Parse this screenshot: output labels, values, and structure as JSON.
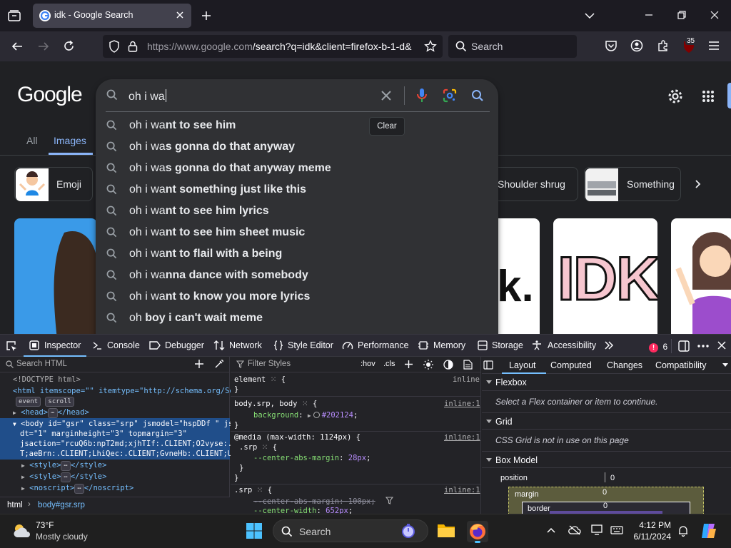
{
  "browser": {
    "tab_title": "idk - Google Search",
    "url_host": "https://www.google.com",
    "url_rest": "/search?q=idk&client=firefox-b-1-d&",
    "search_placeholder": "Search",
    "extension_badge": "35"
  },
  "page": {
    "logo": "Google",
    "tabs": [
      "All",
      "Images"
    ],
    "chips": [
      {
        "label": "Emoji"
      },
      {
        "label": "Shoulder shrug"
      },
      {
        "label": "Something"
      }
    ],
    "thumb_text": "IDK",
    "thumb_text_partial": "k."
  },
  "search": {
    "query": "oh i wa",
    "clear_tooltip": "Clear",
    "suggestions": [
      {
        "prefix": "oh i wa",
        "suffix": "nt to see him"
      },
      {
        "prefix": "oh i wa",
        "suffix": "s gonna do that anyway"
      },
      {
        "prefix": "oh i wa",
        "suffix": "s gonna do that anyway meme"
      },
      {
        "prefix": "oh i wa",
        "suffix": "nt something just like this"
      },
      {
        "prefix": "oh i wa",
        "suffix": "nt to see him lyrics"
      },
      {
        "prefix": "oh i wa",
        "suffix": "nt to see him sheet music"
      },
      {
        "prefix": "oh i wa",
        "suffix": "nt to flail with a being"
      },
      {
        "prefix": "oh i wa",
        "suffix": "nna dance with somebody"
      },
      {
        "prefix": "oh i wa",
        "suffix": "nt to know you more lyrics"
      },
      {
        "prefix": "oh ",
        "suffix": "boy i can't wait meme"
      }
    ]
  },
  "devtools": {
    "tabs": [
      "Inspector",
      "Console",
      "Debugger",
      "Network",
      "Style Editor",
      "Performance",
      "Memory",
      "Storage",
      "Accessibility"
    ],
    "error_count": "6",
    "search_html_placeholder": "Search HTML",
    "filter_styles_placeholder": "Filter Styles",
    "hov": ":hov",
    "cls": ".cls",
    "html_lines": {
      "doctype": "<!DOCTYPE html>",
      "html_open": "<html itemscope=\"\" itemtype=\"http://schema.org/Sear",
      "badge_event": "event",
      "badge_scroll": "scroll",
      "head": "<head>",
      "head_close": "</head>",
      "body1": "<body id=\"gsr\" class=\"srp\" jsmodel=\"hspDDf \" jsco",
      "body2": "dt=\"1\" marginheight=\"3\" topmargin=\"3\"",
      "body3": "jsaction=\"rcuQ6b:npT2md;xjhTIf:.CLIENT;O2vyse:.CL",
      "body4": "T;aeBrn:.CLIENT;LhiQec:.CLIENT;GvneHb:.CLIENT;UjQ",
      "style1": "<style>",
      "style1_close": "</style>",
      "style2": "<style>",
      "style2_close": "</style>",
      "noscript": "<noscript>",
      "noscript_close": "</noscript>"
    },
    "breadcrumbs": [
      "html",
      "body#gsr.srp"
    ],
    "rules": {
      "element_selector": "element",
      "element_src": "inline",
      "r1_selector": "body.srp, body",
      "r1_src": "inline:1",
      "r1_prop": "background",
      "r1_val": "#202124",
      "media": "@media (max-width: 1124px) {",
      "media_src": "inline:1",
      "r2_selector": ".srp",
      "r2_prop": "--center-abs-margin",
      "r2_val": "28px",
      "r3_selector": ".srp",
      "r3_src": "inline:1",
      "r3_prop1": "--center-abs-margin",
      "r3_val1": "100px",
      "r3_prop2": "--center-width",
      "r3_val2": "652px"
    },
    "layout_tabs": [
      "Layout",
      "Computed",
      "Changes",
      "Compatibility"
    ],
    "flexbox_title": "Flexbox",
    "flexbox_note": "Select a Flex container or item to continue.",
    "grid_title": "Grid",
    "grid_note": "CSS Grid is not in use on this page",
    "boxmodel_title": "Box Model",
    "box_position": "position",
    "box_position_val": "0",
    "box_margin": "margin",
    "box_margin_val": "0",
    "box_border": "border",
    "box_border_val": "0"
  },
  "taskbar": {
    "weather_temp": "73°F",
    "weather_desc": "Mostly cloudy",
    "search_placeholder": "Search",
    "time": "4:12 PM",
    "date": "6/11/2024"
  },
  "colors": {
    "page_bg": "#202124",
    "accent_blue": "#8ab4f8",
    "devtools_selection": "#204e8a"
  }
}
